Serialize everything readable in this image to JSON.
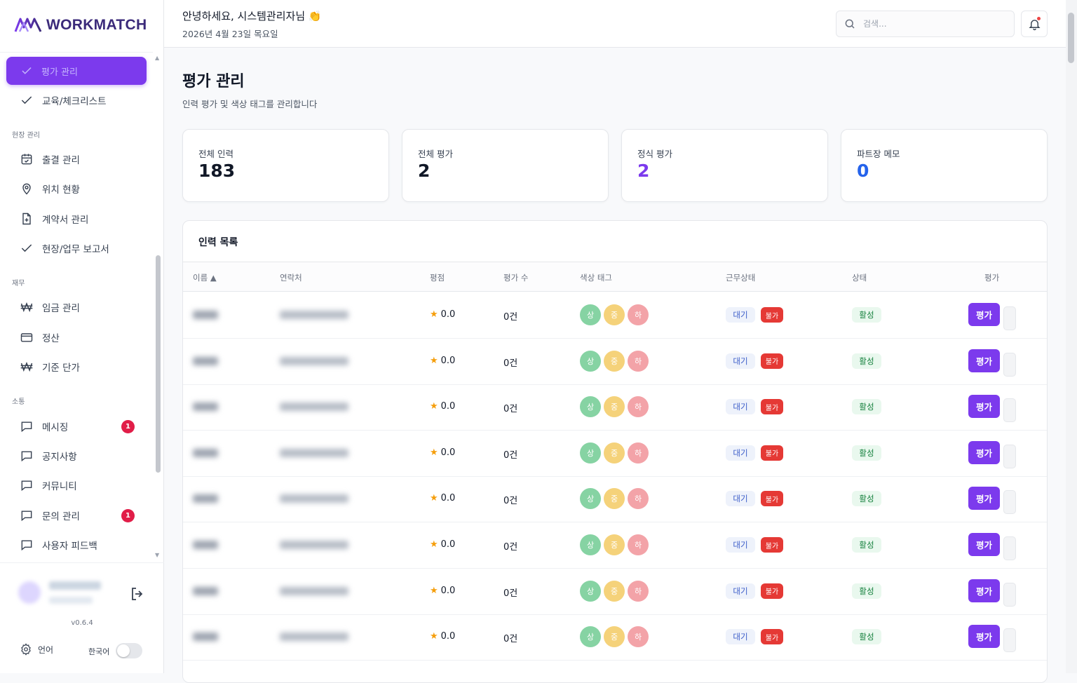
{
  "brand": {
    "name": "WORKMATCH",
    "colors": {
      "primary": "#7c3aed",
      "danger": "#e53935",
      "success": "#15803d",
      "info": "#3b5cc9",
      "value_purple": "#7c3aed",
      "value_blue": "#2563eb"
    }
  },
  "sidebar": {
    "active_item": {
      "label": "평가 관리",
      "icon": "check-icon"
    },
    "items": [
      {
        "label": "교육/체크리스트",
        "icon": "check-icon"
      }
    ],
    "sections": [
      {
        "title": "현장 관리",
        "items": [
          {
            "label": "출결 관리",
            "icon": "calendar-icon"
          },
          {
            "label": "위치 현황",
            "icon": "map-pin-icon"
          },
          {
            "label": "계약서 관리",
            "icon": "file-plus-icon"
          },
          {
            "label": "현장/업무 보고서",
            "icon": "check-icon"
          }
        ]
      },
      {
        "title": "재무",
        "items": [
          {
            "label": "임금 관리",
            "icon": "won-icon"
          },
          {
            "label": "정산",
            "icon": "credit-card-icon"
          },
          {
            "label": "기준 단가",
            "icon": "won-icon"
          }
        ]
      },
      {
        "title": "소통",
        "items": [
          {
            "label": "메시징",
            "icon": "message-icon",
            "badge": "1"
          },
          {
            "label": "공지사항",
            "icon": "message-icon"
          },
          {
            "label": "커뮤니티",
            "icon": "message-icon"
          },
          {
            "label": "문의 관리",
            "icon": "message-icon",
            "badge": "1"
          },
          {
            "label": "사용자 피드백",
            "icon": "message-icon"
          }
        ]
      }
    ],
    "footer": {
      "version": "v0.6.4",
      "language_label": "언어",
      "language_value": "한국어"
    }
  },
  "header": {
    "greeting": "안녕하세요, 시스템관리자님 👏",
    "date": "2026년 4월 23일 목요일",
    "search_placeholder": "검색..."
  },
  "page": {
    "title": "평가 관리",
    "subtitle": "인력 평가 및 색상 태그를 관리합니다"
  },
  "stats": [
    {
      "label": "전체 인력",
      "value": "183"
    },
    {
      "label": "전체 평가",
      "value": "2"
    },
    {
      "label": "정식 평가",
      "value": "2"
    },
    {
      "label": "파트장 메모",
      "value": "0"
    }
  ],
  "table": {
    "title": "인력 목록",
    "columns": [
      "이름 ▲",
      "연락처",
      "평점",
      "평가 수",
      "색상 태그",
      "근무상태",
      "상태",
      "평가"
    ],
    "tag_labels": [
      "상",
      "중",
      "하"
    ],
    "rows": [
      {
        "rating": "0.0",
        "count": "0건",
        "work_status": "대기",
        "work_flag": "불가",
        "status": "활성",
        "action": "평가"
      },
      {
        "rating": "0.0",
        "count": "0건",
        "work_status": "대기",
        "work_flag": "불가",
        "status": "활성",
        "action": "평가"
      },
      {
        "rating": "0.0",
        "count": "0건",
        "work_status": "대기",
        "work_flag": "불가",
        "status": "활성",
        "action": "평가"
      },
      {
        "rating": "0.0",
        "count": "0건",
        "work_status": "대기",
        "work_flag": "불가",
        "status": "활성",
        "action": "평가"
      },
      {
        "rating": "0.0",
        "count": "0건",
        "work_status": "대기",
        "work_flag": "불가",
        "status": "활성",
        "action": "평가"
      },
      {
        "rating": "0.0",
        "count": "0건",
        "work_status": "대기",
        "work_flag": "불가",
        "status": "활성",
        "action": "평가"
      },
      {
        "rating": "0.0",
        "count": "0건",
        "work_status": "대기",
        "work_flag": "불가",
        "status": "활성",
        "action": "평가"
      },
      {
        "rating": "0.0",
        "count": "0건",
        "work_status": "대기",
        "work_flag": "불가",
        "status": "활성",
        "action": "평가"
      }
    ]
  }
}
